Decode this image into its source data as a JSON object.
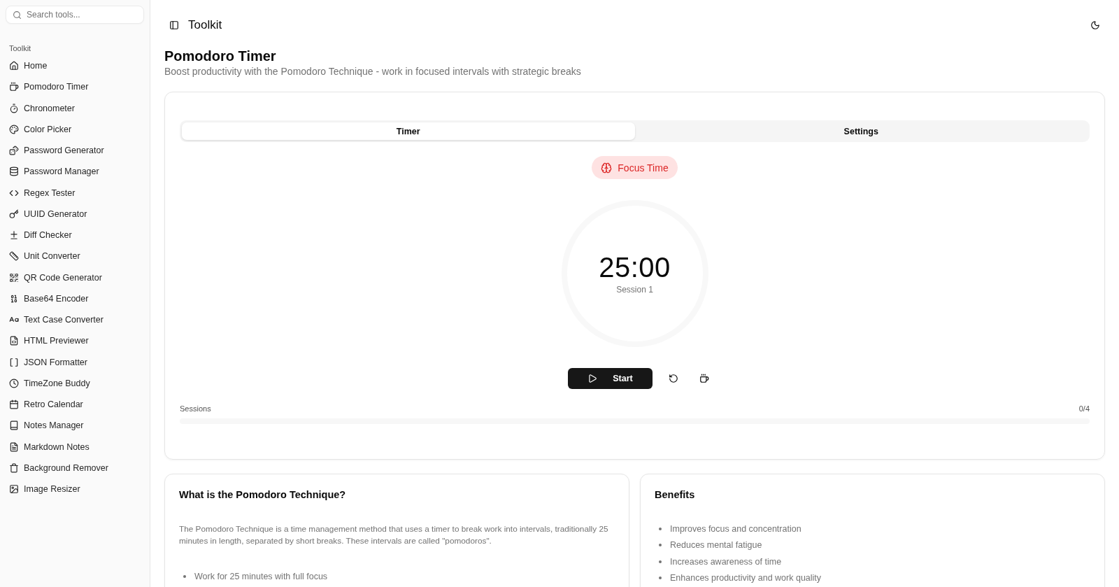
{
  "sidebar": {
    "search": {
      "placeholder": "Search tools..."
    },
    "group_label": "Toolkit",
    "items": [
      {
        "label": "Home"
      },
      {
        "label": "Pomodoro Timer"
      },
      {
        "label": "Chronometer"
      },
      {
        "label": "Color Picker"
      },
      {
        "label": "Password Generator"
      },
      {
        "label": "Password Manager"
      },
      {
        "label": "Regex Tester"
      },
      {
        "label": "UUID Generator"
      },
      {
        "label": "Diff Checker"
      },
      {
        "label": "Unit Converter"
      },
      {
        "label": "QR Code Generator"
      },
      {
        "label": "Base64 Encoder"
      },
      {
        "label": "Text Case Converter"
      },
      {
        "label": "HTML Previewer"
      },
      {
        "label": "JSON Formatter"
      },
      {
        "label": "TimeZone Buddy"
      },
      {
        "label": "Retro Calendar"
      },
      {
        "label": "Notes Manager"
      },
      {
        "label": "Markdown Notes"
      },
      {
        "label": "Background Remover"
      },
      {
        "label": "Image Resizer"
      }
    ]
  },
  "header": {
    "title": "Toolkit"
  },
  "page": {
    "title": "Pomodoro Timer",
    "subtitle": "Boost productivity with the Pomodoro Technique - work in focused intervals with strategic breaks"
  },
  "timer_card": {
    "tabs": [
      {
        "label": "Timer",
        "selected": true
      },
      {
        "label": "Settings",
        "selected": false
      }
    ],
    "mode": "Focus Time",
    "time": "25:00",
    "session": "Session 1",
    "start_button": "Start",
    "sessions": {
      "label": "Sessions",
      "count": "0/4",
      "level": 0
    }
  },
  "info_cards": [
    {
      "title": "What is the Pomodoro Technique?",
      "paragraph": "The Pomodoro Technique is a time management method that uses a timer to break work into intervals, traditionally 25 minutes in length, separated by short breaks. These intervals are called \"pomodoros\".",
      "bullets": [
        "Work for 25 minutes with full focus"
      ]
    },
    {
      "title": "Benefits",
      "bullets": [
        "Improves focus and concentration",
        "Reduces mental fatigue",
        "Increases awareness of time",
        "Enhances productivity and work quality"
      ]
    }
  ]
}
